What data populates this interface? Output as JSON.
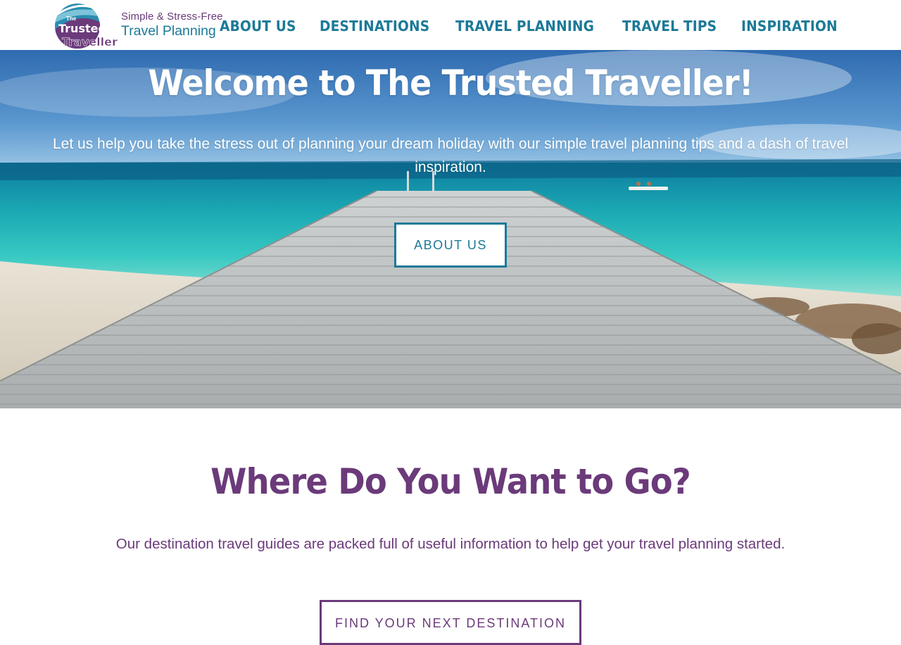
{
  "header": {
    "logo": {
      "mark_small": "The",
      "mark_line1": "Trusted",
      "mark_line2": "Traveller",
      "tagline_part1": "Simple",
      "tagline_amp": "&",
      "tagline_part2": "Stress-Free",
      "tagline_line2": "Travel Planning"
    },
    "nav": [
      {
        "label": "ABOUT US"
      },
      {
        "label": "DESTINATIONS"
      },
      {
        "label": "TRAVEL PLANNING"
      },
      {
        "label": "TRAVEL TIPS"
      },
      {
        "label": "INSPIRATION"
      }
    ]
  },
  "hero": {
    "title": "Welcome to The Trusted Traveller!",
    "subtitle": "Let us help you take the stress out of planning your dream holiday with our simple travel planning tips and a dash of travel inspiration.",
    "button_label": "ABOUT US"
  },
  "destinations": {
    "title": "Where Do You Want to Go?",
    "subtitle": "Our destination travel guides are packed full of useful information to help get your travel planning started.",
    "button_label": "FIND YOUR NEXT DESTINATION"
  },
  "colors": {
    "brand_teal": "#1c7a98",
    "brand_purple": "#6b3a7a",
    "white": "#ffffff"
  }
}
